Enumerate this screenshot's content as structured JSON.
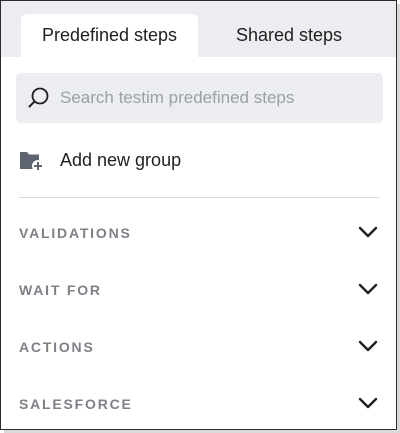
{
  "tabs": [
    {
      "label": "Predefined steps",
      "active": true
    },
    {
      "label": "Shared steps",
      "active": false
    }
  ],
  "search": {
    "placeholder": "Search testim predefined steps",
    "value": "",
    "icon": "search-icon"
  },
  "add_group": {
    "label": "Add new group",
    "icon": "folder-add-icon"
  },
  "sections": [
    {
      "title": "VALIDATIONS",
      "icon": "chevron-down-icon"
    },
    {
      "title": "WAIT FOR",
      "icon": "chevron-down-icon"
    },
    {
      "title": "ACTIONS",
      "icon": "chevron-down-icon"
    },
    {
      "title": "SALESFORCE",
      "icon": "chevron-down-icon"
    }
  ],
  "colors": {
    "tab_bar_bg": "#ecedf0",
    "search_bg": "#ecedf0",
    "section_title": "#7d8087",
    "text": "#1f1f1f",
    "icon": "#5f6570"
  }
}
